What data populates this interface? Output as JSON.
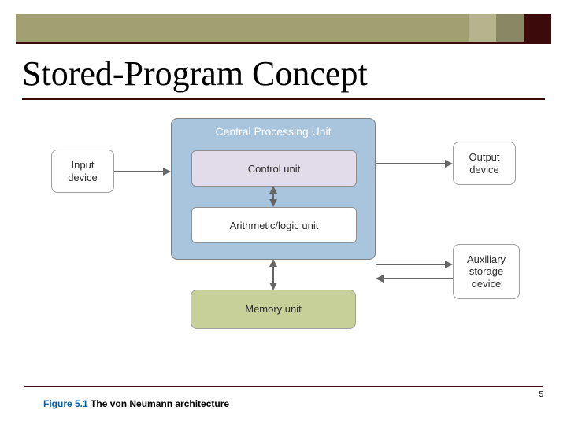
{
  "title": "Stored-Program Concept",
  "diagram": {
    "input": "Input\ndevice",
    "output": "Output\ndevice",
    "aux": "Auxiliary\nstorage\ndevice",
    "cpu_label": "Central Processing Unit",
    "control": "Control unit",
    "alu": "Arithmetic/logic unit",
    "memory": "Memory unit"
  },
  "caption": {
    "num": "Figure 5.1",
    "text": " The von Neumann architecture"
  },
  "page": "5",
  "colors": {
    "band": "#a29f73",
    "maroon": "#3c0a0a",
    "cpu_bg": "#a9c4dd",
    "control_bg": "#e2dcea",
    "memory_bg": "#c8d09a"
  }
}
